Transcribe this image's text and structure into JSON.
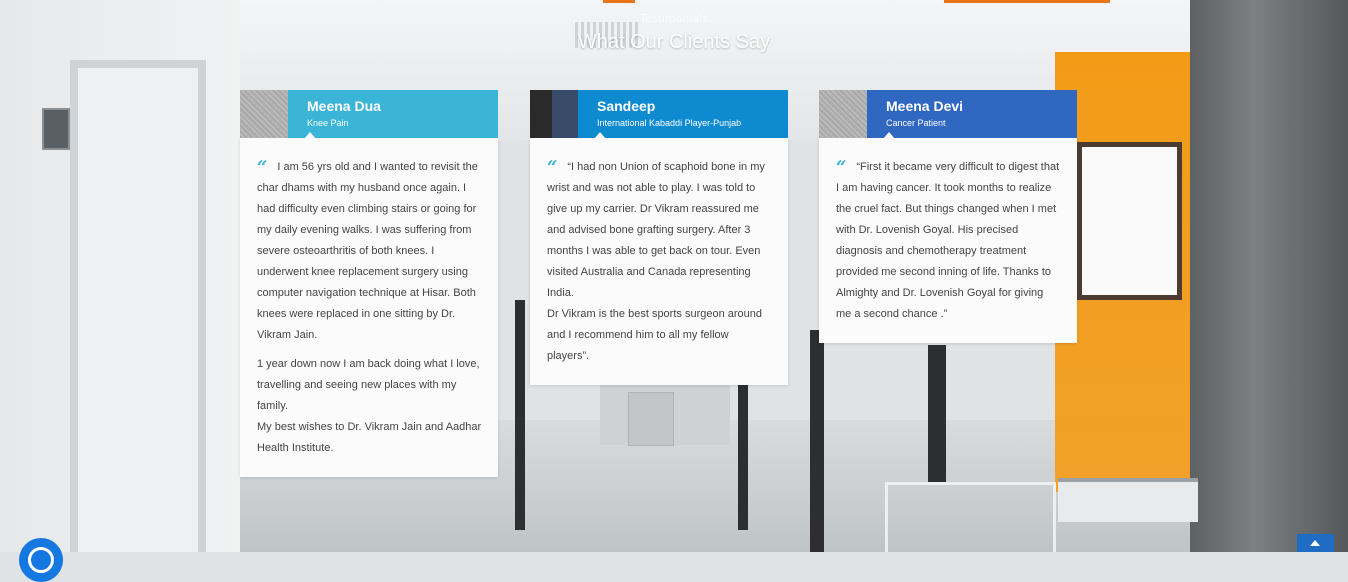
{
  "section": {
    "eyebrow": "Testimonials",
    "title": "What Our Clients Say"
  },
  "colors": {
    "accent_1": "#3ab5d8",
    "accent_2": "#0e8ad0",
    "accent_3": "#2f67c1",
    "quote_mark": "#3bb0da"
  },
  "testimonials": [
    {
      "name": "Meena Dua",
      "role": "Knee Pain",
      "avatar": "placeholder-avatar",
      "quote_mark": "“",
      "p1": "I am 56 yrs old and I wanted to revisit the char dhams with my husband once again. I had difficulty even climbing stairs or going for my daily evening walks. I was suffering from severe osteoarthritis of both knees.  I underwent knee replacement surgery using computer navigation technique at Hisar. Both knees were replaced in one sitting by Dr. Vikram Jain.",
      "p2": "1 year down now I am back doing what I love, travelling and seeing new places with my family.",
      "p3": "My best wishes to Dr. Vikram Jain and Aadhar Health Institute."
    },
    {
      "name": "Sandeep",
      "role": "International Kabaddi Player-Punjab",
      "avatar": "photo-avatar",
      "quote_mark": "“",
      "p1": "“I had non Union of scaphoid bone in my wrist and was not able to play. I was told to give up my carrier. Dr Vikram reassured me and advised bone grafting surgery. After 3 months I was able to get back on tour. Even visited Australia and Canada representing India.",
      "p2": "Dr Vikram is the best sports surgeon around and I recommend him to all my fellow players”."
    },
    {
      "name": "Meena Devi",
      "role": "Cancer Patient",
      "avatar": "placeholder-avatar",
      "quote_mark": "“",
      "p1": "“First it became very difficult to digest that I am having cancer.  It took months to realize the cruel fact.  But things changed when I met with Dr. Lovenish Goyal.  His precised diagnosis and chemotherapy treatment provided me second inning of life.  Thanks to  Almighty and Dr. Lovenish Goyal for giving me a second chance .”"
    }
  ],
  "widgets": {
    "scroll_top_icon": "chevron-up-icon",
    "chat_icon": "chat-icon"
  }
}
